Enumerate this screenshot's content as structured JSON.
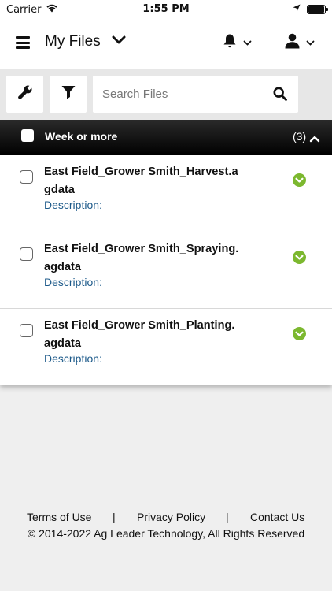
{
  "status_bar": {
    "carrier": "Carrier",
    "time": "1:55 PM"
  },
  "header": {
    "title": "My Files"
  },
  "toolbar": {
    "search_placeholder": "Search Files"
  },
  "group": {
    "label": "Week or more",
    "count": "(3)"
  },
  "files": [
    {
      "name": "East Field_Grower Smith_Harvest.agdata",
      "description_label": "Description:",
      "status": "synced"
    },
    {
      "name": "East Field_Grower Smith_Spraying.agdata",
      "description_label": "Description:",
      "status": "synced"
    },
    {
      "name": "East Field_Grower Smith_Planting.agdata",
      "description_label": "Description:",
      "status": "synced"
    }
  ],
  "footer": {
    "links": [
      "Terms of Use",
      "Privacy Policy",
      "Contact Us"
    ],
    "separator": "|",
    "copyright": "© 2014-2022 Ag Leader Technology, All Rights Reserved"
  },
  "colors": {
    "status_ok": "#7cb82f",
    "description_link": "#1d5a8a",
    "group_header_bg": "#000000"
  },
  "icons": {
    "menu": "menu-icon",
    "dropdown": "chevron-down-icon",
    "bell": "bell-icon",
    "user": "user-icon",
    "wrench": "wrench-icon",
    "filter": "filter-icon",
    "search": "search-icon",
    "collapse": "chevron-up-icon",
    "status": "check-circle-icon"
  }
}
